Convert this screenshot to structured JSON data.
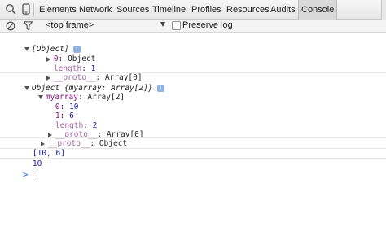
{
  "tabs": [
    {
      "label": "Elements"
    },
    {
      "label": "Network"
    },
    {
      "label": "Sources"
    },
    {
      "label": "Timeline"
    },
    {
      "label": "Profiles"
    },
    {
      "label": "Resources"
    },
    {
      "label": "Audits"
    },
    {
      "label": "Console",
      "active": true
    }
  ],
  "toolbar": {
    "frame": "<top frame>",
    "preserve_log_label": "Preserve log",
    "preserve_log_checked": false
  },
  "console": {
    "msg1": {
      "header": "[Object]",
      "child_key": "0",
      "child_value": "Object",
      "length_key": "length",
      "length_value": "1",
      "proto_key": "__proto__",
      "proto_value": "Array[0]"
    },
    "msg2": {
      "header": "Object {myarray: Array[2]}",
      "prop_key": "myarray",
      "prop_value": "Array[2]",
      "item0_key": "0",
      "item0_value": "10",
      "item1_key": "1",
      "item1_value": "6",
      "length_key": "length",
      "length_value": "2",
      "inner_proto_key": "__proto__",
      "inner_proto_value": "Array[0]",
      "outer_proto_key": "__proto__",
      "outer_proto_value": "Object"
    },
    "msg3": "[10, 6]",
    "msg4": "10",
    "prompt": ">"
  },
  "colors": {
    "key_purple": "#881280",
    "number_blue": "#1a1aa6",
    "prompt_blue": "#2f75d8",
    "info_badge": "#8fb3e6"
  },
  "icons": [
    "inspect-icon",
    "device-mode-icon",
    "clear-console-icon",
    "filter-icon",
    "info-icon"
  ]
}
